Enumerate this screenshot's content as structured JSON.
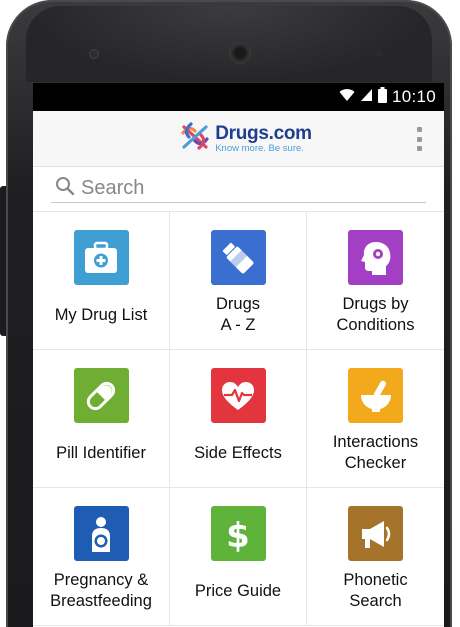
{
  "status_bar": {
    "time": "10:10"
  },
  "app_bar": {
    "logo_name": "Drugs.com",
    "logo_tagline": "Know more. Be sure."
  },
  "search": {
    "placeholder": "Search"
  },
  "grid": {
    "items": [
      {
        "label": "My Drug List",
        "icon": "medical-bag-icon",
        "color": "#3f9fd3"
      },
      {
        "label": "Drugs\nA - Z",
        "icon": "pill-bottle-icon",
        "color": "#3a6fd0"
      },
      {
        "label": "Drugs by\nConditions",
        "icon": "head-brain-icon",
        "color": "#a23fc5"
      },
      {
        "label": "Pill Identifier",
        "icon": "capsule-icon",
        "color": "#6fae32"
      },
      {
        "label": "Side Effects",
        "icon": "heart-pulse-icon",
        "color": "#e3353d"
      },
      {
        "label": "Interactions\nChecker",
        "icon": "mortar-pestle-icon",
        "color": "#f2a91c"
      },
      {
        "label": "Pregnancy &\nBreastfeeding",
        "icon": "mother-baby-icon",
        "color": "#1f5db4"
      },
      {
        "label": "Price Guide",
        "icon": "dollar-icon",
        "color": "#5fb33b"
      },
      {
        "label": "Phonetic\nSearch",
        "icon": "megaphone-icon",
        "color": "#a5732a"
      }
    ]
  }
}
